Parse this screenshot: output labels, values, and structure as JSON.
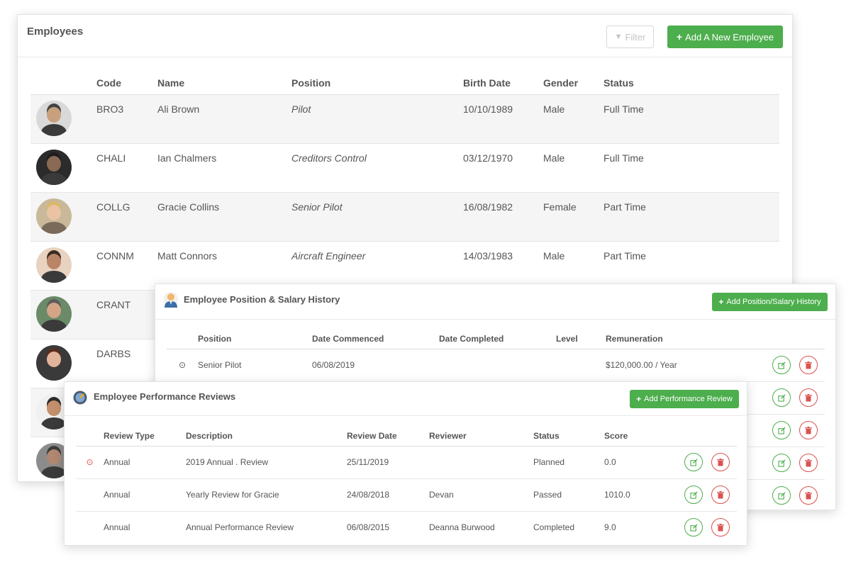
{
  "employees": {
    "title": "Employees",
    "filter_label": "Filter",
    "add_label": "Add A New Employee",
    "columns": [
      "",
      "Code",
      "Name",
      "Position",
      "Birth Date",
      "Gender",
      "Status"
    ],
    "rows": [
      {
        "code": "BRO3",
        "name": "Ali Brown",
        "position": "Pilot",
        "birth_date": "10/10/1989",
        "gender": "Male",
        "status": "Full Time"
      },
      {
        "code": "CHALI",
        "name": "Ian Chalmers",
        "position": "Creditors Control",
        "birth_date": "03/12/1970",
        "gender": "Male",
        "status": "Full Time"
      },
      {
        "code": "COLLG",
        "name": "Gracie Collins",
        "position": "Senior Pilot",
        "birth_date": "16/08/1982",
        "gender": "Female",
        "status": "Part Time"
      },
      {
        "code": "CONNM",
        "name": "Matt Connors",
        "position": "Aircraft Engineer",
        "birth_date": "14/03/1983",
        "gender": "Male",
        "status": "Part Time"
      },
      {
        "code": "CRANT",
        "name": "",
        "position": "",
        "birth_date": "",
        "gender": "",
        "status": ""
      },
      {
        "code": "DARBS",
        "name": "",
        "position": "",
        "birth_date": "",
        "gender": "",
        "status": ""
      },
      {
        "code": "",
        "name": "",
        "position": "",
        "birth_date": "",
        "gender": "",
        "status": ""
      },
      {
        "code": "",
        "name": "",
        "position": "",
        "birth_date": "",
        "gender": "",
        "status": ""
      }
    ]
  },
  "salary_history": {
    "title": "Employee Position & Salary History",
    "add_label": "Add Position/Salary History",
    "columns": [
      "",
      "Position",
      "Date Commenced",
      "Date Completed",
      "Level",
      "Remuneration",
      ""
    ],
    "rows": [
      {
        "position": "Senior Pilot",
        "date_commenced": "06/08/2019",
        "date_completed": "",
        "level": "",
        "remuneration": "$120,000.00 / Year"
      },
      {
        "position": "",
        "date_commenced": "",
        "date_completed": "",
        "level": "",
        "remuneration": ""
      },
      {
        "position": "",
        "date_commenced": "",
        "date_completed": "",
        "level": "",
        "remuneration": ""
      },
      {
        "position": "",
        "date_commenced": "",
        "date_completed": "",
        "level": "",
        "remuneration": ""
      },
      {
        "position": "",
        "date_commenced": "",
        "date_completed": "",
        "level": "",
        "remuneration": ""
      }
    ]
  },
  "performance_reviews": {
    "title": "Employee Performance Reviews",
    "add_label": "Add Performance Review",
    "columns": [
      "",
      "Review Type",
      "Description",
      "Review Date",
      "Reviewer",
      "Status",
      "Score",
      ""
    ],
    "rows": [
      {
        "review_type": "Annual",
        "description": "2019 Annual . Review",
        "review_date": "25/11/2019",
        "reviewer": "",
        "status": "Planned",
        "score": "0.0"
      },
      {
        "review_type": "Annual",
        "description": "Yearly Review for Gracie",
        "review_date": "24/08/2018",
        "reviewer": "Devan",
        "status": "Passed",
        "score": "1010.0"
      },
      {
        "review_type": "Annual",
        "description": "Annual Performance Review",
        "review_date": "06/08/2015",
        "reviewer": "Deanna Burwood",
        "status": "Completed",
        "score": "9.0"
      }
    ]
  },
  "icons": {
    "filter": "filter-icon",
    "plus": "plus-icon",
    "edit": "edit-icon",
    "delete": "trash-icon",
    "clock": "clock-icon",
    "alert": "alert-circle-icon",
    "user": "user-icon",
    "review": "review-badge-icon"
  },
  "colors": {
    "accent_green": "#4cae4c",
    "danger_red": "#d9534f",
    "row_stripe": "#f5f5f5"
  }
}
